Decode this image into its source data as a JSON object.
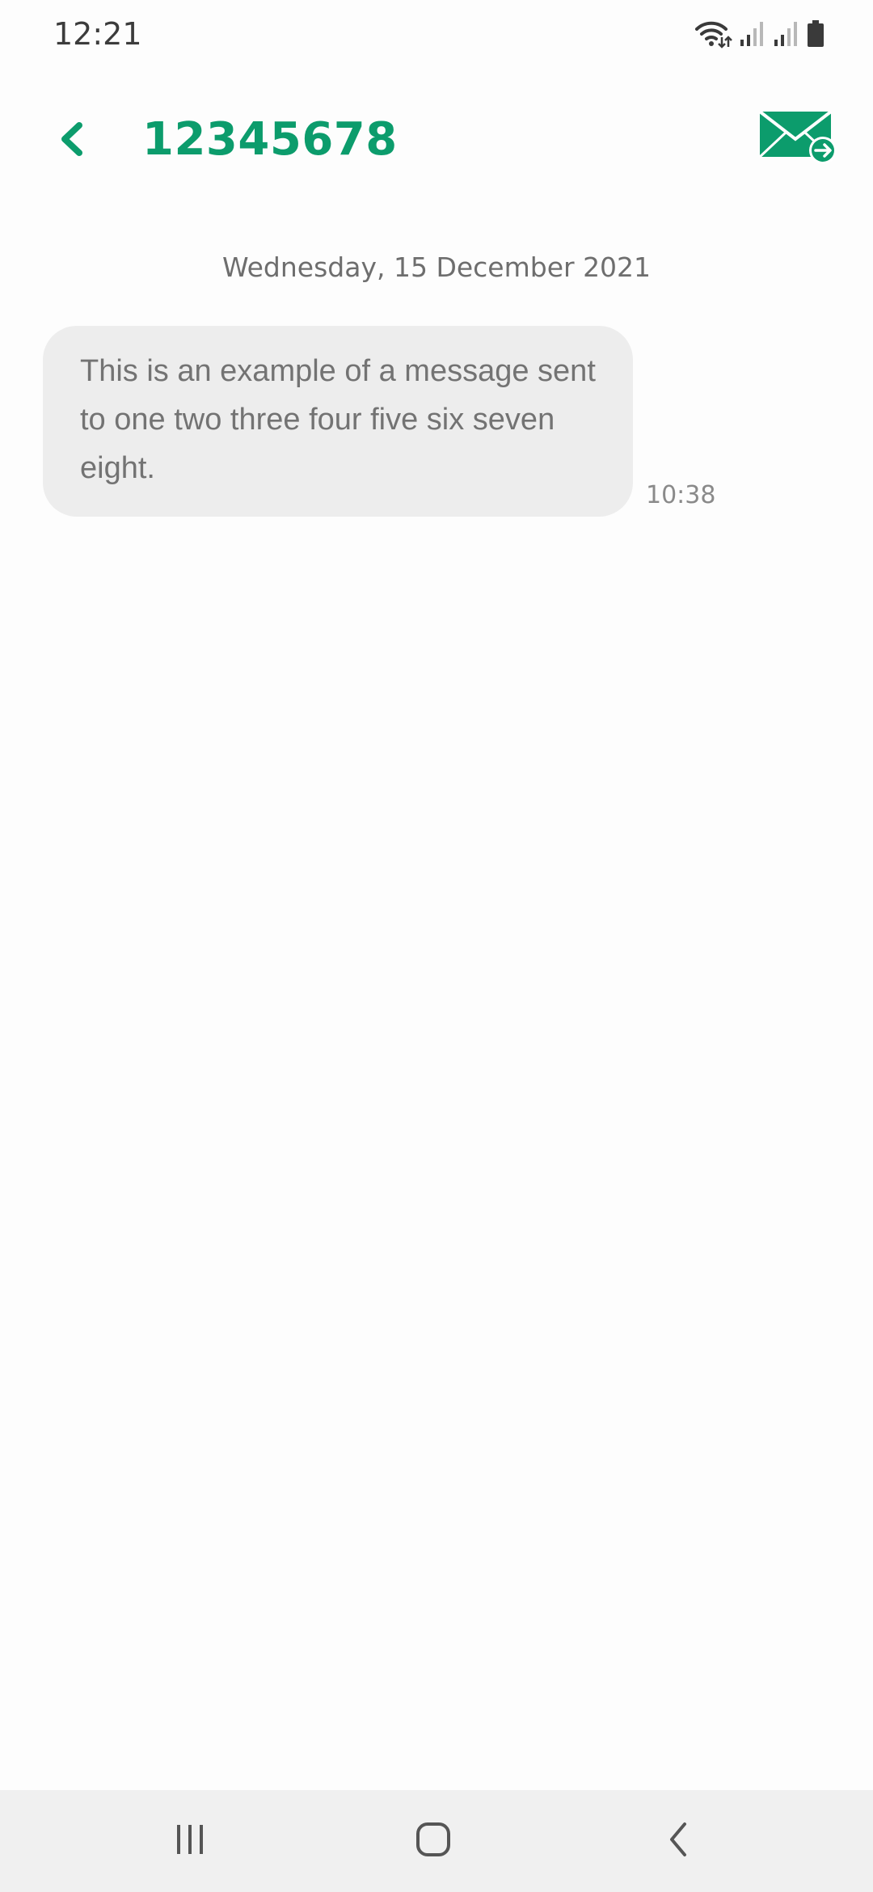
{
  "status_bar": {
    "time": "12:21",
    "icons": [
      "wifi-icon",
      "signal-icon",
      "signal-icon",
      "battery-icon"
    ]
  },
  "header": {
    "back_icon": "chevron-left-icon",
    "title": "12345678",
    "compose_icon": "mail-forward-icon"
  },
  "conversation": {
    "date": "Wednesday, 15 December 2021",
    "messages": [
      {
        "text": "This is an example of a message sent to one two three four five six seven eight.",
        "time": "10:38"
      }
    ]
  },
  "nav_bar": {
    "recents_icon": "recents-icon",
    "home_icon": "home-icon",
    "back_icon": "back-icon"
  },
  "colors": {
    "accent": "#0c9c6c",
    "bubble": "#ededed",
    "background": "#fdfdfd",
    "nav_bar": "#f0f0f0"
  }
}
